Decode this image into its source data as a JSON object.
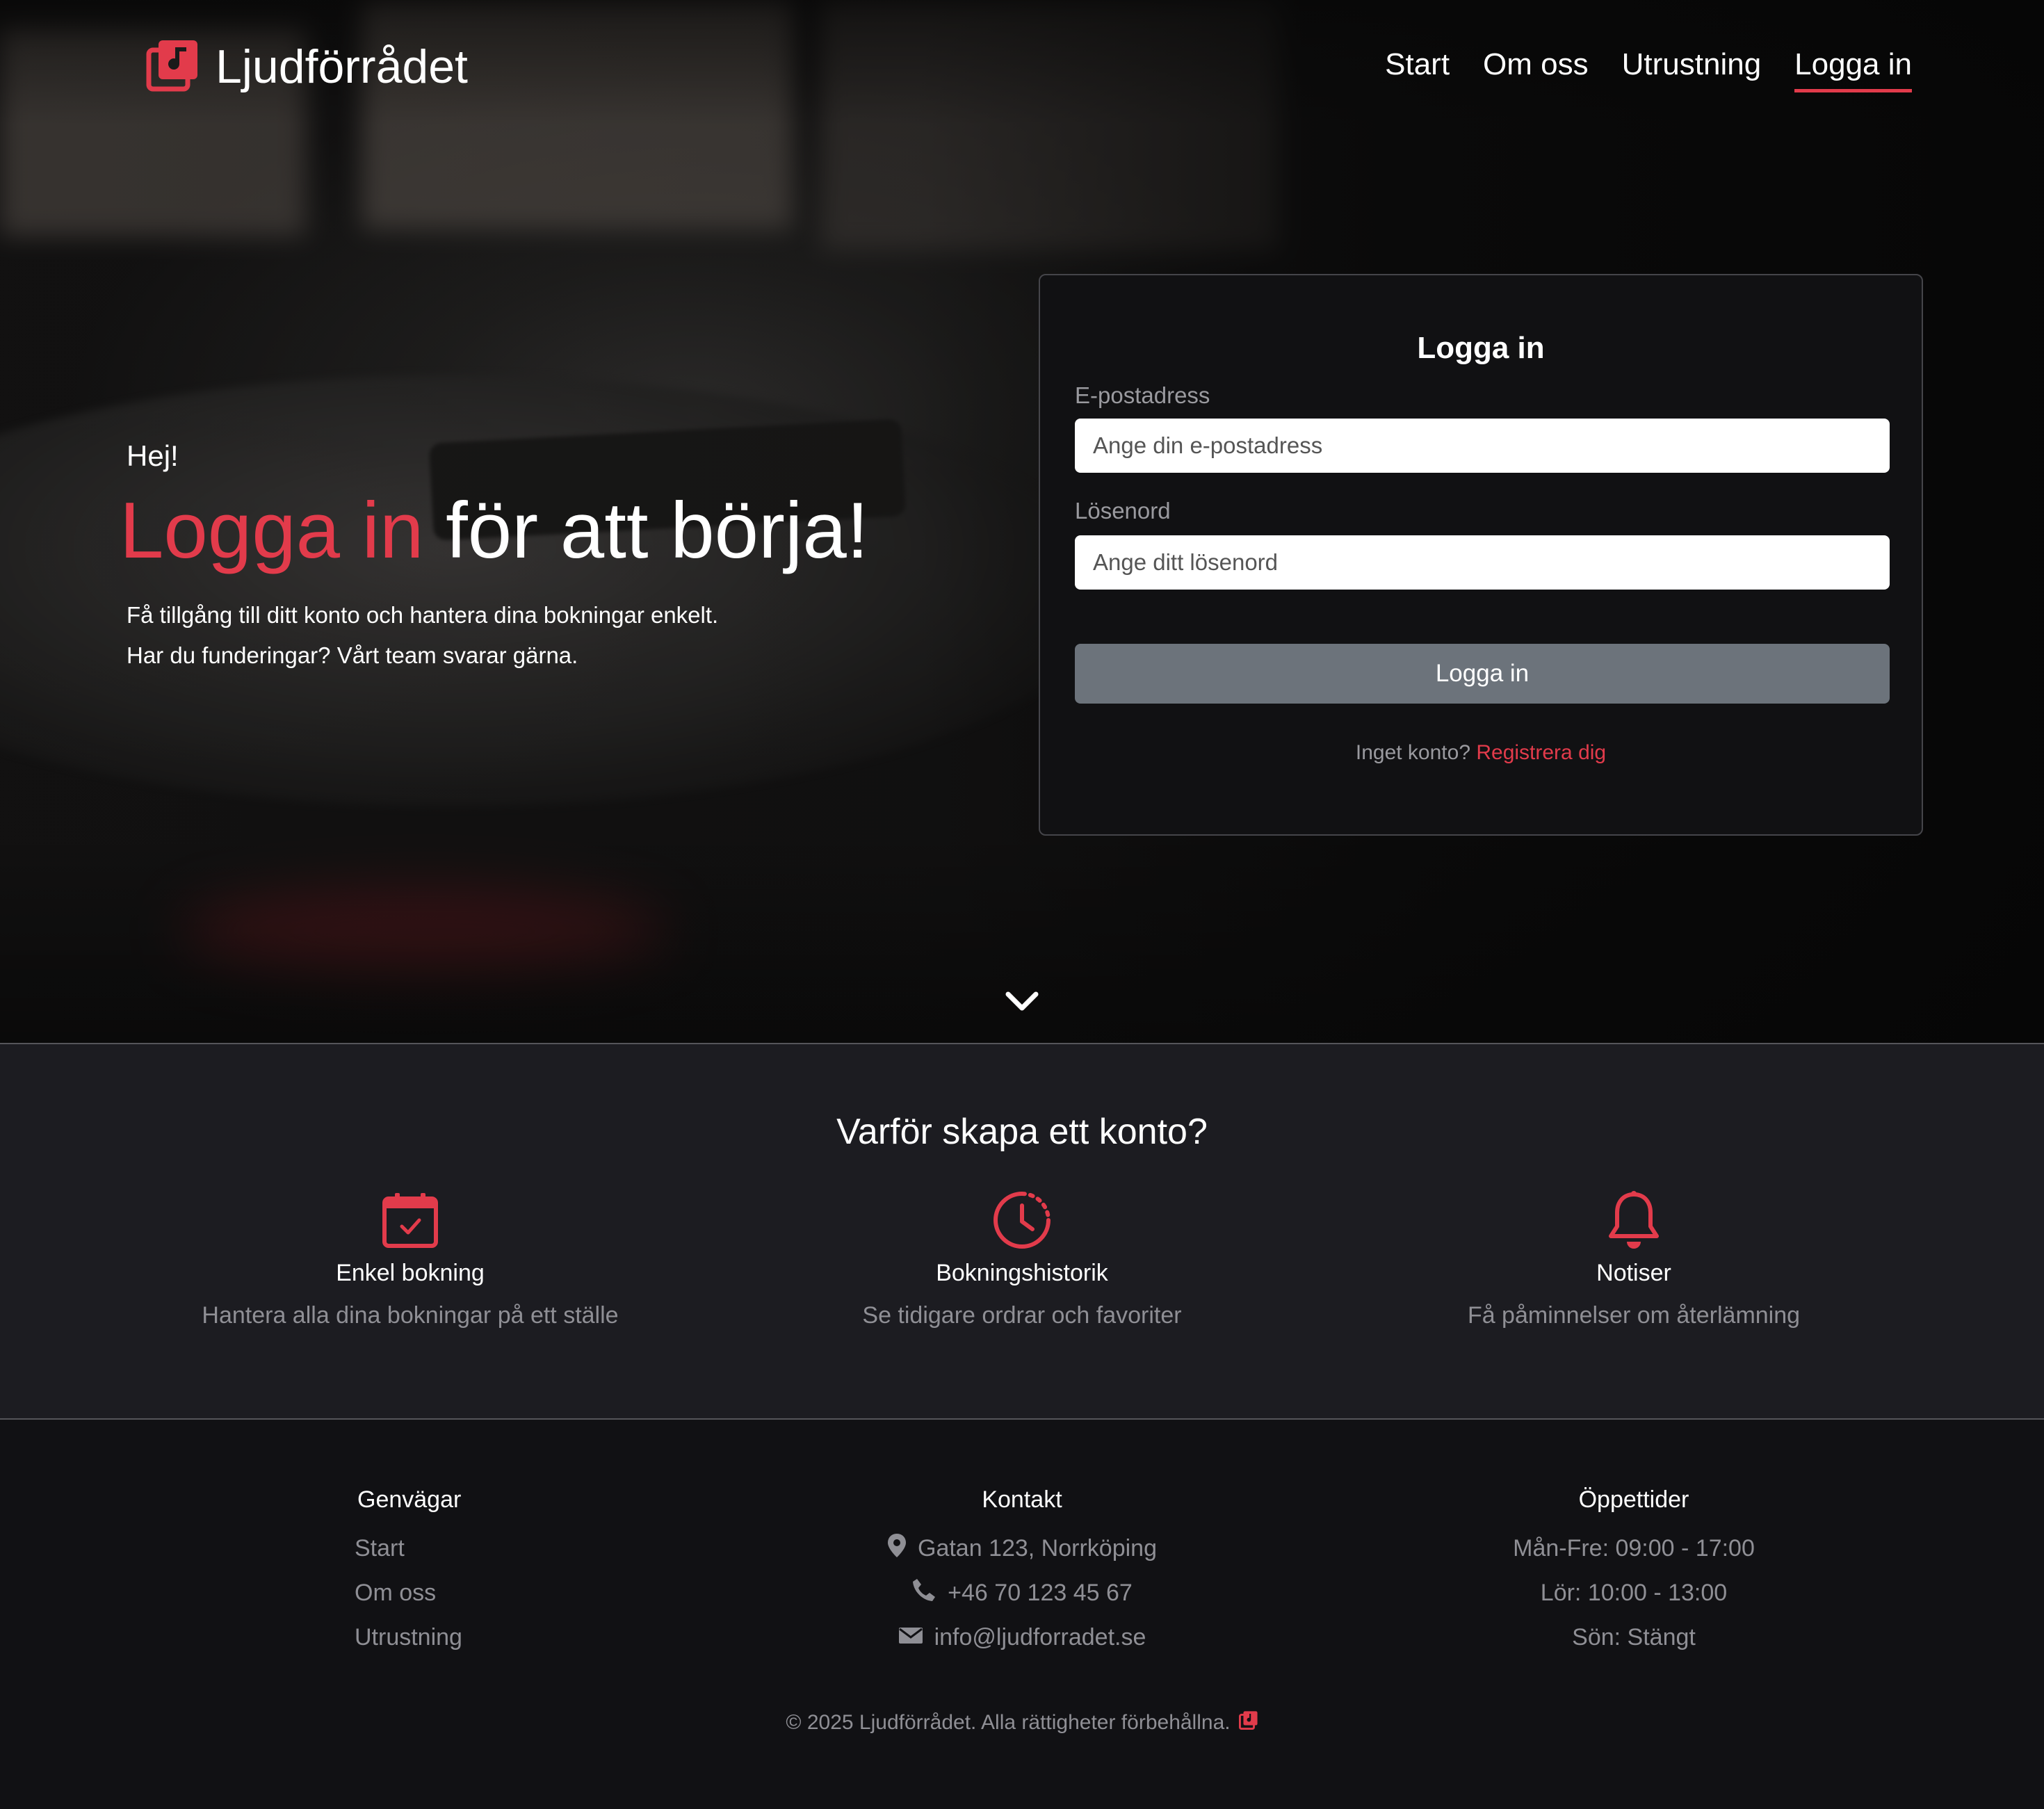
{
  "brand": {
    "name": "Ljudförrådet",
    "accent_color": "#e23b4b",
    "icon": "music-note-stack-icon"
  },
  "nav": {
    "items": [
      {
        "label": "Start"
      },
      {
        "label": "Om oss"
      },
      {
        "label": "Utrustning"
      },
      {
        "label": "Logga in",
        "active": true
      }
    ]
  },
  "hero": {
    "greeting": "Hej!",
    "headline_accent": "Logga in",
    "headline_rest": " för att börja!",
    "lead_1": "Få tillgång till ditt konto och hantera dina bokningar enkelt.",
    "lead_2": "Har du funderingar? Vårt team svarar gärna."
  },
  "login": {
    "title": "Logga in",
    "email_label": "E-postadress",
    "email_placeholder": "Ange din e-postadress",
    "email_value": "",
    "password_label": "Lösenord",
    "password_placeholder": "Ange ditt lösenord",
    "password_value": "",
    "submit_label": "Logga in",
    "no_account_text": "Inget konto? ",
    "register_link": "Registrera dig"
  },
  "features": {
    "title": "Varför skapa ett konto?",
    "items": [
      {
        "icon": "calendar-check-icon",
        "title": "Enkel bokning",
        "desc": "Hantera alla dina bokningar på ett ställe"
      },
      {
        "icon": "clock-history-icon",
        "title": "Bokningshistorik",
        "desc": "Se tidigare ordrar och favoriter"
      },
      {
        "icon": "bell-icon",
        "title": "Notiser",
        "desc": "Få påminnelser om återlämning"
      }
    ]
  },
  "footer": {
    "shortcuts": {
      "title": "Genvägar",
      "links": [
        "Start",
        "Om oss",
        "Utrustning"
      ]
    },
    "contact": {
      "title": "Kontakt",
      "address": "Gatan 123, Norrköping",
      "phone": "+46 70 123 45 67",
      "email": "info@ljudforradet.se"
    },
    "hours": {
      "title": "Öppettider",
      "weekdays": "Mån-Fre: 09:00 - 17:00",
      "saturday": "Lör: 10:00 - 13:00",
      "sunday": "Sön: Stängt"
    },
    "copyright": "© 2025 Ljudförrådet. Alla rättigheter förbehållna."
  }
}
